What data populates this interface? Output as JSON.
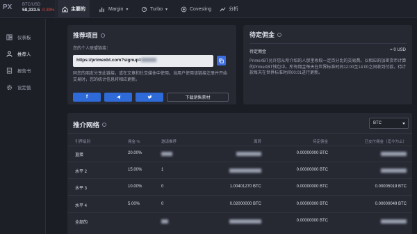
{
  "topbar": {
    "logo": "PX",
    "pair": "BTC/USD",
    "price": "58,333.5",
    "change": "-0.39%",
    "nav": [
      {
        "label": "主要的",
        "icon": "home-icon"
      },
      {
        "label": "Margin",
        "icon": "margin-chart-icon"
      },
      {
        "label": "Turbo",
        "icon": "turbo-icon"
      },
      {
        "label": "Covesting",
        "icon": "covesting-icon"
      },
      {
        "label": "分析",
        "icon": "analytics-icon"
      }
    ]
  },
  "sidebar": {
    "items": [
      {
        "label": "仪表板",
        "icon": "dashboard-icon"
      },
      {
        "label": "推荐人",
        "icon": "referral-user-icon"
      },
      {
        "label": "报告书",
        "icon": "report-icon"
      },
      {
        "label": "设定值",
        "icon": "settings-gear-icon"
      }
    ]
  },
  "referral": {
    "title": "推荐项目",
    "link_label": "您的个人联盟链接：",
    "link_value": "https://primexbt.com?signup=",
    "description": "同您的朋友分享此链接，或在文章和社交媒体中使用。当用户使用该链接注册并开始交易时，您的统计信息将相应更新。",
    "share_icons": [
      "facebook-icon",
      "telegram-icon",
      "twitter-icon"
    ],
    "download_label": "下载销售素材"
  },
  "pending": {
    "title": "待定佣金",
    "label": "待定佣金",
    "value": "= 0 USD",
    "note": "PrimeXBT允许您从所介绍的人那里收取一定百分比的交易费。以相应的加密货币计算的PrimeXBT钱包中。所有佣金每天在世界标准时间12:00至14:00之间收到付款。待计款每天在世界标准时间00:01进行更新。"
  },
  "network": {
    "title": "推介网络",
    "currency": "BTC",
    "columns": [
      "引荐级别",
      "佣金 %",
      "邀请推荐",
      "周转",
      "待定佣金",
      "已支付佣金（迄今为止）"
    ],
    "rows": [
      {
        "level": "直接",
        "pct": "20.00%",
        "refs": "",
        "turnover": "",
        "pending": "0.00000000 BTC",
        "paid": ""
      },
      {
        "level": "水平 2",
        "pct": "15.00%",
        "refs": "1",
        "turnover": "",
        "pending": "0.00000000 BTC",
        "paid": ""
      },
      {
        "level": "水平 3",
        "pct": "10.00%",
        "refs": "0",
        "turnover": "1.00401270 BTC",
        "pending": "0.00000000 BTC",
        "paid": "0.00005019 BTC"
      },
      {
        "level": "水平 4",
        "pct": "5.00%",
        "refs": "0",
        "turnover": "0.02000000 BTC",
        "pending": "0.00000000 BTC",
        "paid": "0.00000049 BTC"
      },
      {
        "level": "全部的",
        "pct": "",
        "refs": "",
        "turnover": "",
        "pending": "0.00000000 BTC",
        "paid": ""
      }
    ]
  }
}
